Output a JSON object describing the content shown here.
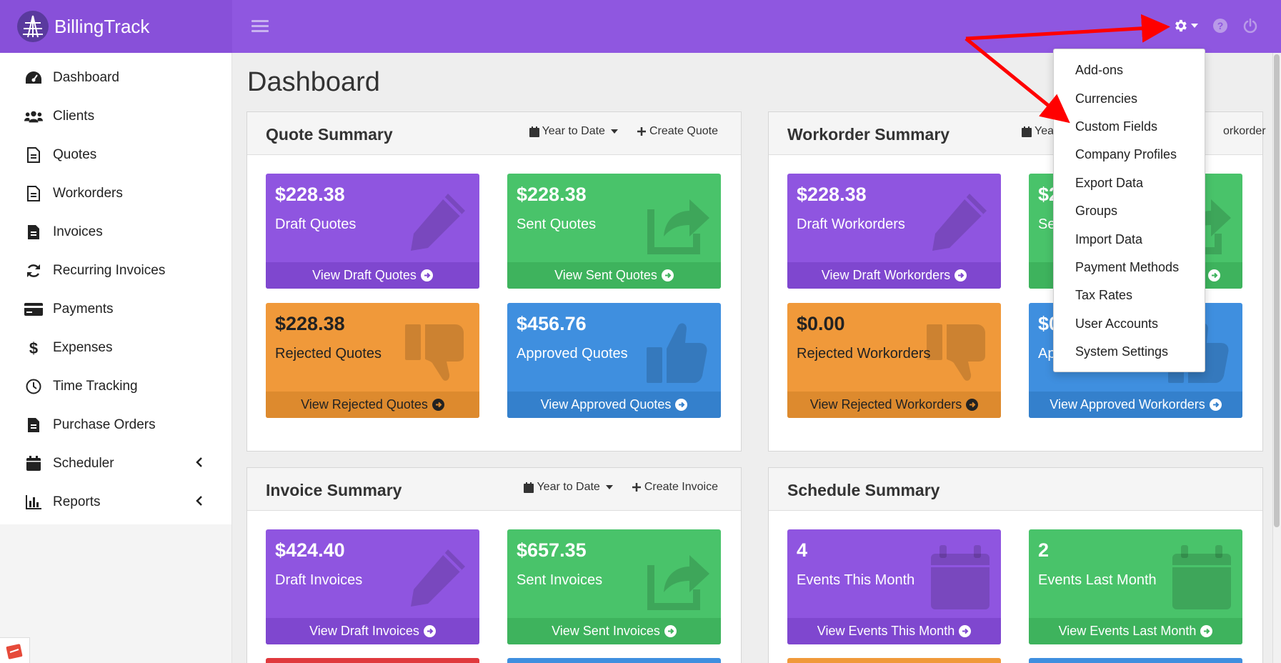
{
  "app": {
    "brand": "BillingTrack"
  },
  "sidebar": {
    "items": [
      {
        "label": "Dashboard",
        "icon": "dashboard-icon"
      },
      {
        "label": "Clients",
        "icon": "users-icon"
      },
      {
        "label": "Quotes",
        "icon": "file-text-icon"
      },
      {
        "label": "Workorders",
        "icon": "file-text-icon"
      },
      {
        "label": "Invoices",
        "icon": "file-icon"
      },
      {
        "label": "Recurring Invoices",
        "icon": "refresh-icon"
      },
      {
        "label": "Payments",
        "icon": "credit-card-icon"
      },
      {
        "label": "Expenses",
        "icon": "dollar-icon"
      },
      {
        "label": "Time Tracking",
        "icon": "clock-icon"
      },
      {
        "label": "Purchase Orders",
        "icon": "file-icon"
      },
      {
        "label": "Scheduler",
        "icon": "calendar-icon",
        "has_children": true
      },
      {
        "label": "Reports",
        "icon": "bar-chart-icon",
        "has_children": true
      }
    ]
  },
  "header": {
    "page_title": "Dashboard"
  },
  "settings_menu": {
    "items": [
      "Add-ons",
      "Currencies",
      "Custom Fields",
      "Company Profiles",
      "Export Data",
      "Groups",
      "Import Data",
      "Payment Methods",
      "Tax Rates",
      "User Accounts",
      "System Settings"
    ]
  },
  "quote_summary": {
    "title": "Quote Summary",
    "period": "Year to Date",
    "create": "Create Quote",
    "cards": [
      {
        "amount": "$228.38",
        "label": "Draft Quotes",
        "link": "View Draft Quotes"
      },
      {
        "amount": "$228.38",
        "label": "Sent Quotes",
        "link": "View Sent Quotes"
      },
      {
        "amount": "$228.38",
        "label": "Rejected Quotes",
        "link": "View Rejected Quotes"
      },
      {
        "amount": "$456.76",
        "label": "Approved Quotes",
        "link": "View Approved Quotes"
      }
    ]
  },
  "workorder_summary": {
    "title": "Workorder Summary",
    "period_visible": "Yea",
    "create_visible": "orkorder",
    "cards": [
      {
        "amount": "$228.38",
        "label": "Draft Workorders",
        "link": "View Draft Workorders"
      },
      {
        "amount_visible": "$2",
        "label_visible": "Se",
        "link_visible": ""
      },
      {
        "amount": "$0.00",
        "label": "Rejected Workorders",
        "link": "View Rejected Workorders"
      },
      {
        "amount_visible": "$0",
        "label_visible": "Ap",
        "link": "View Approved Workorders"
      }
    ]
  },
  "invoice_summary": {
    "title": "Invoice Summary",
    "period": "Year to Date",
    "create": "Create Invoice",
    "cards": [
      {
        "amount": "$424.40",
        "label": "Draft Invoices",
        "link": "View Draft Invoices"
      },
      {
        "amount": "$657.35",
        "label": "Sent Invoices",
        "link": "View Sent Invoices"
      }
    ]
  },
  "schedule_summary": {
    "title": "Schedule Summary",
    "cards": [
      {
        "amount": "4",
        "label": "Events This Month",
        "link": "View Events This Month"
      },
      {
        "amount": "2",
        "label": "Events Last Month",
        "link": "View Events Last Month"
      }
    ]
  },
  "colors": {
    "topbar": "#8f57e0",
    "purple": "#8f55e0",
    "green": "#49c36a",
    "orange": "#f0993a",
    "blue": "#3f8fdf",
    "red": "#e0393d",
    "annotation_arrow": "#ff0000"
  }
}
